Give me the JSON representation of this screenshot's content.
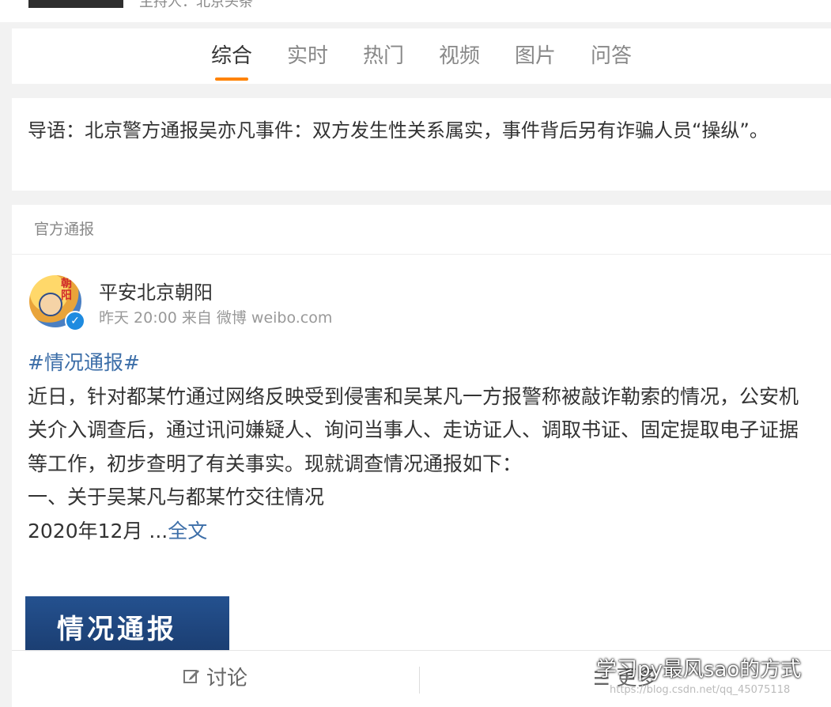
{
  "top": {
    "host_label": "主持人：北京头条"
  },
  "tabs": [
    {
      "label": "综合",
      "active": true
    },
    {
      "label": "实时"
    },
    {
      "label": "热门"
    },
    {
      "label": "视频"
    },
    {
      "label": "图片"
    },
    {
      "label": "问答"
    }
  ],
  "guide": {
    "text": "导语：北京警方通报吴亦凡事件：双方发生性关系属实，事件背后另有诈骗人员“操纵”。"
  },
  "section": {
    "title": "官方通报"
  },
  "post": {
    "avatar_text": "朝阳",
    "author": "平安北京朝阳",
    "meta": "昨天 20:00 来自 微博 weibo.com",
    "hashtag": "#情况通报#",
    "paragraph": "近日，针对都某竹通过网络反映受到侵害和吴某凡一方报警称被敲诈勒索的情况，公安机关介入调查后，通过讯问嫌疑人、询问当事人、走访证人、调取书证、固定提取电子证据等工作，初步查明了有关事实。现就调查情况通报如下：",
    "line_1": "一、关于吴某凡与都某竹交往情况",
    "line_2": "2020年12月 ...",
    "fulltext_link": "全文",
    "image_text": "情况通报"
  },
  "actions": {
    "discuss": "讨论",
    "more": "更多"
  },
  "watermark": {
    "text": "学习py最风sao的方式",
    "url": "https://blog.csdn.net/qq_45075118"
  },
  "colors": {
    "accent": "#ff8200",
    "link": "#3c6ea8",
    "verified": "#1e8be0"
  }
}
